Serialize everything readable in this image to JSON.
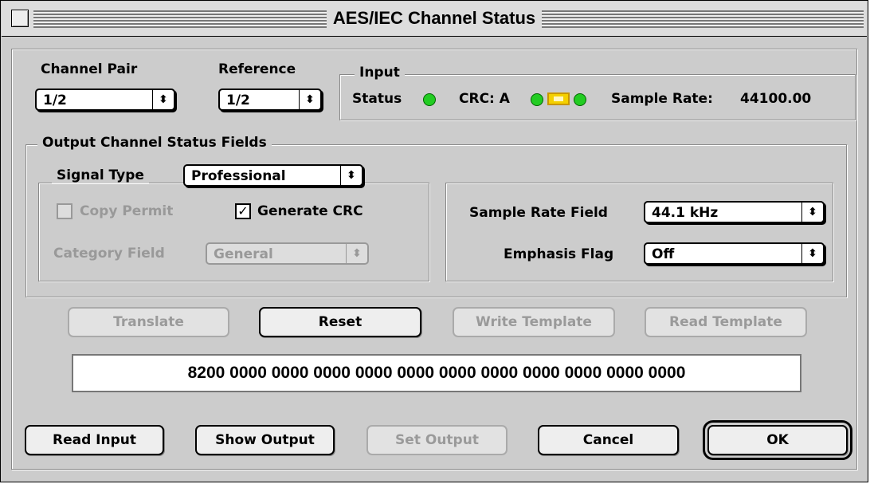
{
  "window": {
    "title": "AES/IEC Channel Status"
  },
  "channel_pair": {
    "label": "Channel Pair",
    "value": "1/2"
  },
  "reference": {
    "label": "Reference",
    "value": "1/2"
  },
  "input": {
    "label": "Input",
    "status_label": "Status",
    "crc_label": "CRC: A",
    "sample_rate_label": "Sample Rate:",
    "sample_rate_value": "44100.00"
  },
  "output": {
    "group_label": "Output Channel Status Fields",
    "signal_type_label": "Signal Type",
    "signal_type_value": "Professional",
    "copy_permit_label": "Copy Permit",
    "generate_crc_label": "Generate CRC",
    "generate_crc_checked": true,
    "category_field_label": "Category Field",
    "category_field_value": "General",
    "sample_rate_field_label": "Sample Rate Field",
    "sample_rate_field_value": "44.1 kHz",
    "emphasis_flag_label": "Emphasis Flag",
    "emphasis_flag_value": "Off"
  },
  "action_buttons": {
    "translate": "Translate",
    "reset": "Reset",
    "write_template": "Write Template",
    "read_template": "Read Template"
  },
  "hex_value": "8200 0000 0000 0000 0000 0000 0000 0000 0000 0000 0000 0000",
  "footer_buttons": {
    "read_input": "Read Input",
    "show_output": "Show Output",
    "set_output": "Set Output",
    "cancel": "Cancel",
    "ok": "OK"
  },
  "colors": {
    "led_green": "#22cc22",
    "crc_indicator": "#f4d000",
    "window_bg": "#cccccc"
  },
  "icons": {
    "popup_arrows": "up-down-arrows-icon",
    "checkbox_check": "check-icon"
  }
}
